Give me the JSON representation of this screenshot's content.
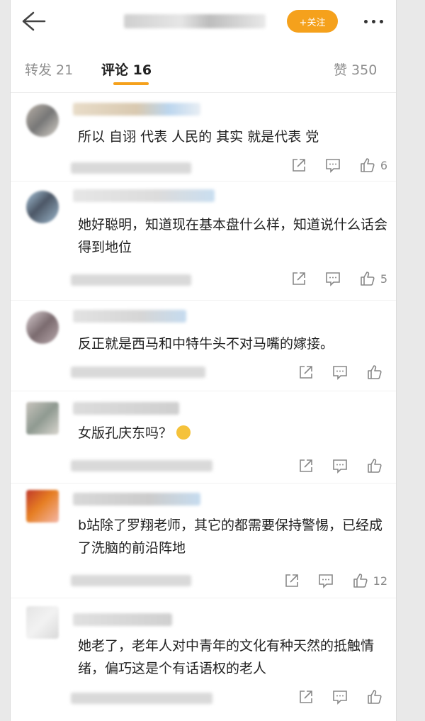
{
  "header": {
    "follow_label": "+关注",
    "colors": {
      "accent": "#f5a11c"
    },
    "icons": [
      "arrow-left-icon",
      "more-dots-icon"
    ]
  },
  "tabs": {
    "repost": "转发 21",
    "comments": "评论 16",
    "likes": "赞 350"
  },
  "comments": [
    {
      "text": "所以 自诩 代表 人民的 其实 就是代表 党",
      "likes": "6"
    },
    {
      "text": "她好聪明，知道现在基本盘什么样，知道说什么话会得到地位",
      "likes": "5"
    },
    {
      "text": "反正就是西马和中特牛头不对马嘴的嫁接。",
      "likes": ""
    },
    {
      "text": "女版孔庆东吗？",
      "likes": "",
      "emoji": "laugh-cry-emoji"
    },
    {
      "text": "b站除了罗翔老师，其它的都需要保持警惕，已经成了洗脑的前沿阵地",
      "likes": "12"
    },
    {
      "text": "她老了，老年人对中青年的文化有种天然的抵触情绪，偏巧这是个有话语权的老人",
      "likes": ""
    }
  ],
  "action_icons": [
    "share-icon",
    "reply-icon",
    "thumbs-up-icon"
  ]
}
